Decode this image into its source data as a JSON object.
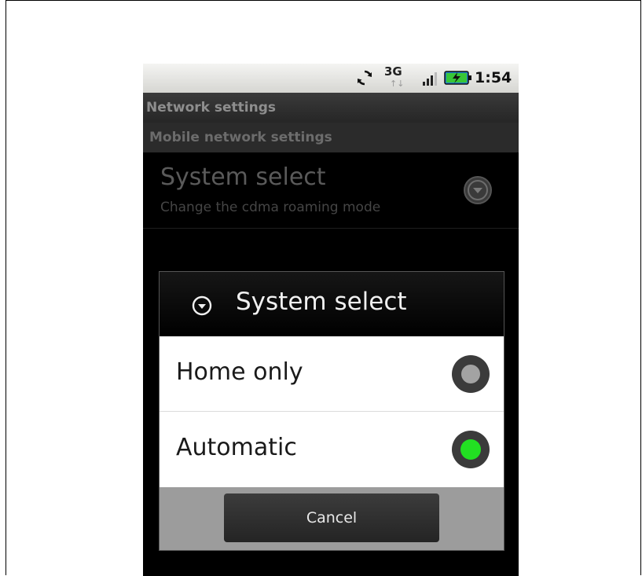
{
  "status_bar": {
    "network": "3G",
    "time": "1:54",
    "icons": [
      "sync-icon",
      "data-activity-icon",
      "signal-icon",
      "battery-charging-icon"
    ]
  },
  "screen": {
    "title": "Network settings",
    "section": "Mobile network settings",
    "preference": {
      "title": "System select",
      "summary": "Change the cdma roaming mode",
      "icon": "chevron-down-circle-icon"
    }
  },
  "dialog": {
    "icon": "chevron-down-circle-icon",
    "title": "System select",
    "options": [
      {
        "label": "Home only",
        "selected": false
      },
      {
        "label": "Automatic",
        "selected": true
      }
    ],
    "cancel_label": "Cancel"
  },
  "colors": {
    "selected_radio": "#22dd22",
    "unselected_radio": "#999999",
    "background": "#000000"
  }
}
